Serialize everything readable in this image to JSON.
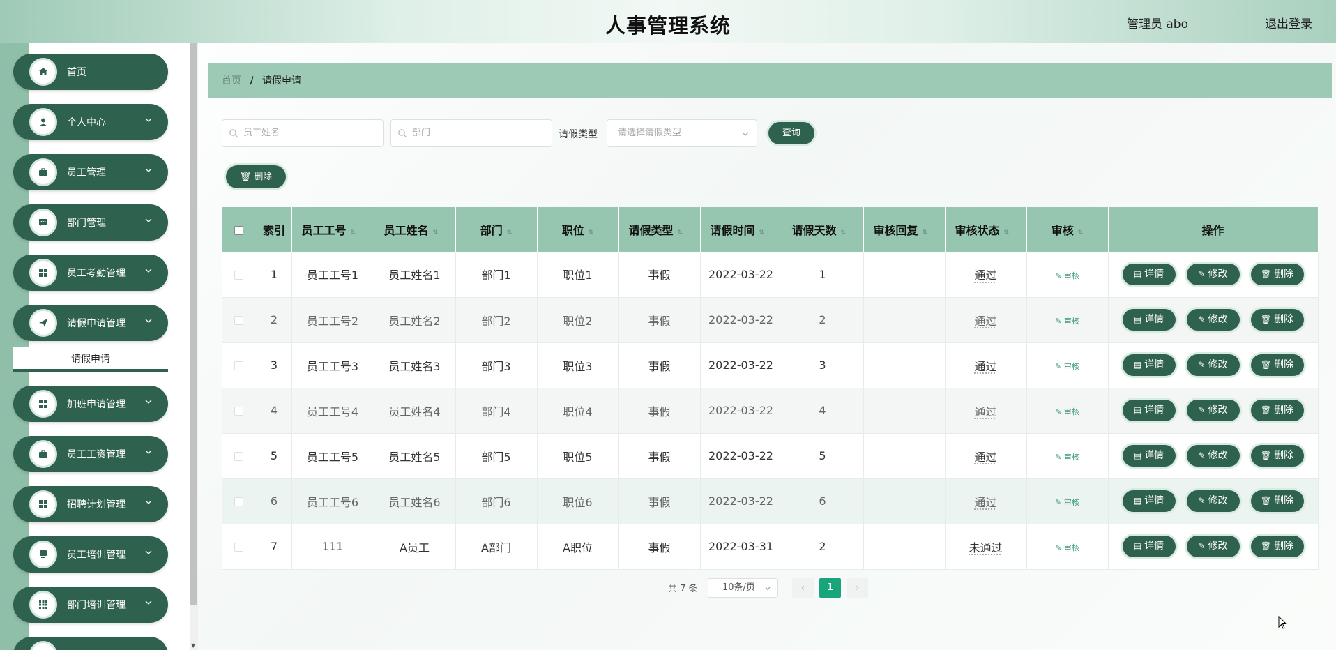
{
  "header": {
    "title": "人事管理系统",
    "user": "管理员 abo",
    "logout": "退出登录"
  },
  "sidebar": {
    "items": [
      {
        "label": "首页",
        "icon": "home-icon"
      },
      {
        "label": "个人中心",
        "icon": "user-icon"
      },
      {
        "label": "员工管理",
        "icon": "briefcase-icon"
      },
      {
        "label": "部门管理",
        "icon": "chat-icon"
      },
      {
        "label": "员工考勤管理",
        "icon": "grid-icon"
      },
      {
        "label": "请假申请管理",
        "icon": "send-icon"
      },
      {
        "label": "加班申请管理",
        "icon": "grid-icon"
      },
      {
        "label": "员工工资管理",
        "icon": "briefcase-icon"
      },
      {
        "label": "招聘计划管理",
        "icon": "grid-icon"
      },
      {
        "label": "员工培训管理",
        "icon": "monitor-icon"
      },
      {
        "label": "部门培训管理",
        "icon": "apps-icon"
      }
    ],
    "submenu_active": "请假申请"
  },
  "breadcrumb": {
    "home": "首页",
    "separator": "/",
    "current": "请假申请"
  },
  "search": {
    "name_placeholder": "员工姓名",
    "dept_placeholder": "部门",
    "type_label": "请假类型",
    "type_placeholder": "请选择请假类型",
    "query_button": "查询"
  },
  "actions": {
    "batch_delete": "删除"
  },
  "table": {
    "headers": [
      "索引",
      "员工工号",
      "员工姓名",
      "部门",
      "职位",
      "请假类型",
      "请假时间",
      "请假天数",
      "审核回复",
      "审核状态",
      "审核",
      "操作"
    ],
    "rows": [
      {
        "index": "1",
        "emp_no": "员工工号1",
        "emp_name": "员工姓名1",
        "dept": "部门1",
        "position": "职位1",
        "leave_type": "事假",
        "leave_date": "2022-03-22",
        "days": "1",
        "reply": "",
        "status": "通过"
      },
      {
        "index": "2",
        "emp_no": "员工工号2",
        "emp_name": "员工姓名2",
        "dept": "部门2",
        "position": "职位2",
        "leave_type": "事假",
        "leave_date": "2022-03-22",
        "days": "2",
        "reply": "",
        "status": "通过"
      },
      {
        "index": "3",
        "emp_no": "员工工号3",
        "emp_name": "员工姓名3",
        "dept": "部门3",
        "position": "职位3",
        "leave_type": "事假",
        "leave_date": "2022-03-22",
        "days": "3",
        "reply": "",
        "status": "通过"
      },
      {
        "index": "4",
        "emp_no": "员工工号4",
        "emp_name": "员工姓名4",
        "dept": "部门4",
        "position": "职位4",
        "leave_type": "事假",
        "leave_date": "2022-03-22",
        "days": "4",
        "reply": "",
        "status": "通过"
      },
      {
        "index": "5",
        "emp_no": "员工工号5",
        "emp_name": "员工姓名5",
        "dept": "部门5",
        "position": "职位5",
        "leave_type": "事假",
        "leave_date": "2022-03-22",
        "days": "5",
        "reply": "",
        "status": "通过"
      },
      {
        "index": "6",
        "emp_no": "员工工号6",
        "emp_name": "员工姓名6",
        "dept": "部门6",
        "position": "职位6",
        "leave_type": "事假",
        "leave_date": "2022-03-22",
        "days": "6",
        "reply": "",
        "status": "通过"
      },
      {
        "index": "7",
        "emp_no": "111",
        "emp_name": "A员工",
        "dept": "A部门",
        "position": "A职位",
        "leave_type": "事假",
        "leave_date": "2022-03-31",
        "days": "2",
        "reply": "",
        "status": "未通过"
      }
    ],
    "audit_link": "审核",
    "op_detail": "详情",
    "op_edit": "修改",
    "op_delete": "删除"
  },
  "pagination": {
    "total": "共 7 条",
    "page_size": "10条/页",
    "current_page": "1",
    "prev": "‹",
    "next": "›"
  },
  "colors": {
    "primary": "#2e614e",
    "header_bg": "#96c6b0",
    "page_active": "#19a57b",
    "stripe": "#8fbfa9"
  }
}
